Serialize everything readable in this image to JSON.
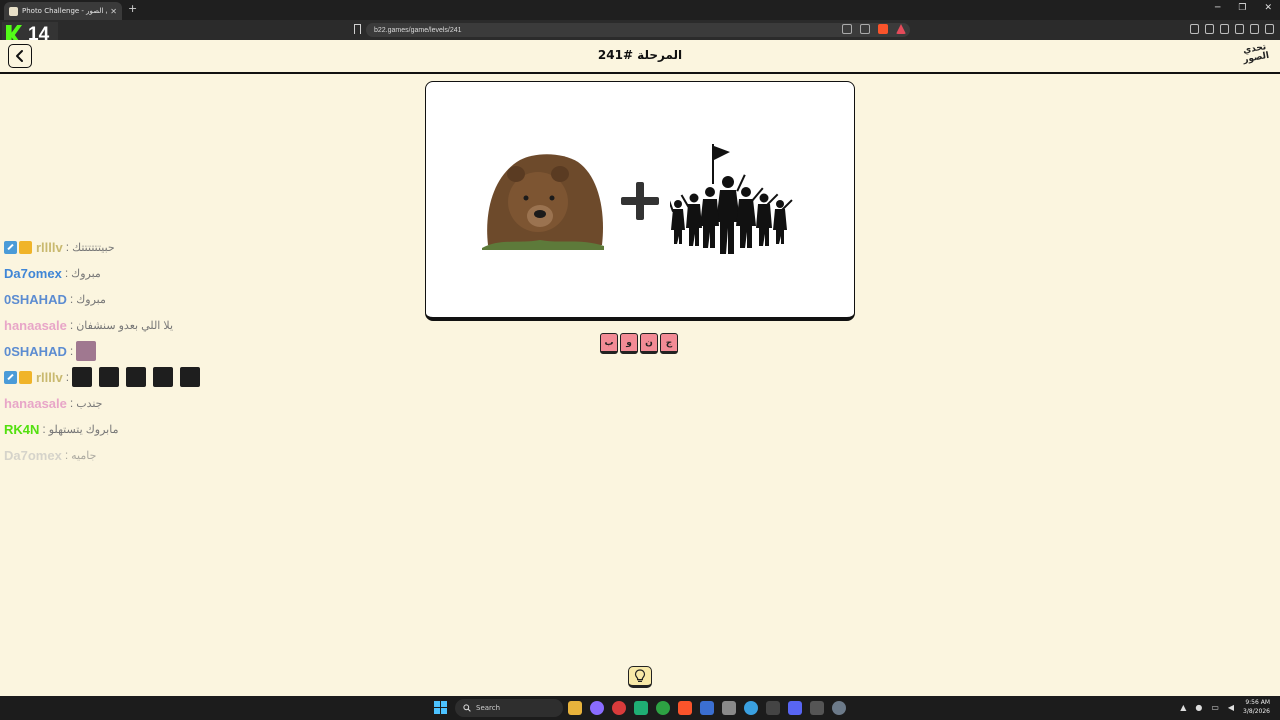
{
  "browser": {
    "tab_title": "Photo Challenge - تحدي الصور",
    "url": "b22.games/game/levels/241"
  },
  "stream": {
    "viewer_count": "14"
  },
  "header": {
    "title": "المرحلة #241",
    "logo_text": "تحدي الصور"
  },
  "answer": {
    "letters": [
      "ب",
      "و",
      "ن",
      "ج"
    ]
  },
  "chat": [
    {
      "user": "rllllv",
      "color": "#c9b96f",
      "message": "حبيتتتتتتك"
    },
    {
      "user": "Da7omex",
      "color": "#3f86d6",
      "message": "مبروك"
    },
    {
      "user": "0SHAHAD",
      "color": "#5c8cd1",
      "message": "مبروك"
    },
    {
      "user": "hanaasale",
      "color": "#e8a6c8",
      "message": "يلا اللي بعدو سنشفان"
    },
    {
      "user": "0SHAHAD",
      "color": "#5c8cd1",
      "message": ""
    },
    {
      "user": "rllllv",
      "color": "#c9b96f",
      "message": ""
    },
    {
      "user": "hanaasale",
      "color": "#e8a6c8",
      "message": "جندب"
    },
    {
      "user": "RK4N",
      "color": "#53e00f",
      "message": "مابروك يتستهلو"
    },
    {
      "user": "Da7omex",
      "color": "#d2d2d2",
      "message": "جاميه"
    }
  ],
  "taskbar": {
    "search_label": "Search",
    "time": "9:56 AM",
    "date": "3/8/2026"
  }
}
